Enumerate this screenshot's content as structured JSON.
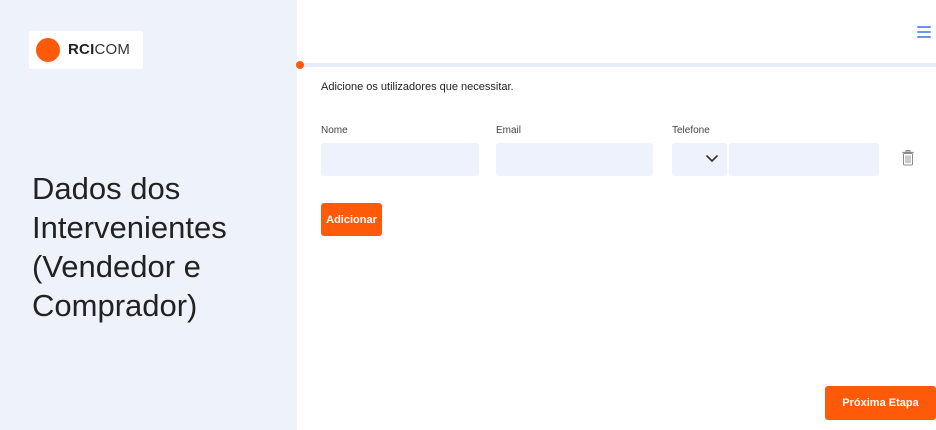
{
  "sidebar": {
    "logo": {
      "bold": "RCI",
      "light": "COM"
    },
    "title": "Dados dos Intervenientes (Vendedor e Comprador)"
  },
  "header": {
    "menu_icon": "hamburger-menu-icon"
  },
  "form": {
    "intro": "Adicione os utilizadores que necessitar.",
    "labels": {
      "nome": "Nome",
      "email": "Email",
      "telefone": "Telefone"
    },
    "values": {
      "nome": "",
      "email": "",
      "telefone": ""
    },
    "add_button": "Adicionar",
    "delete_icon": "trash-icon"
  },
  "footer": {
    "next_button": "Próxima Etapa"
  },
  "colors": {
    "accent": "#ff5a0a",
    "sidebar_bg": "#eef2fb",
    "input_bg": "#edf2fd",
    "menu": "#6d95e8"
  }
}
